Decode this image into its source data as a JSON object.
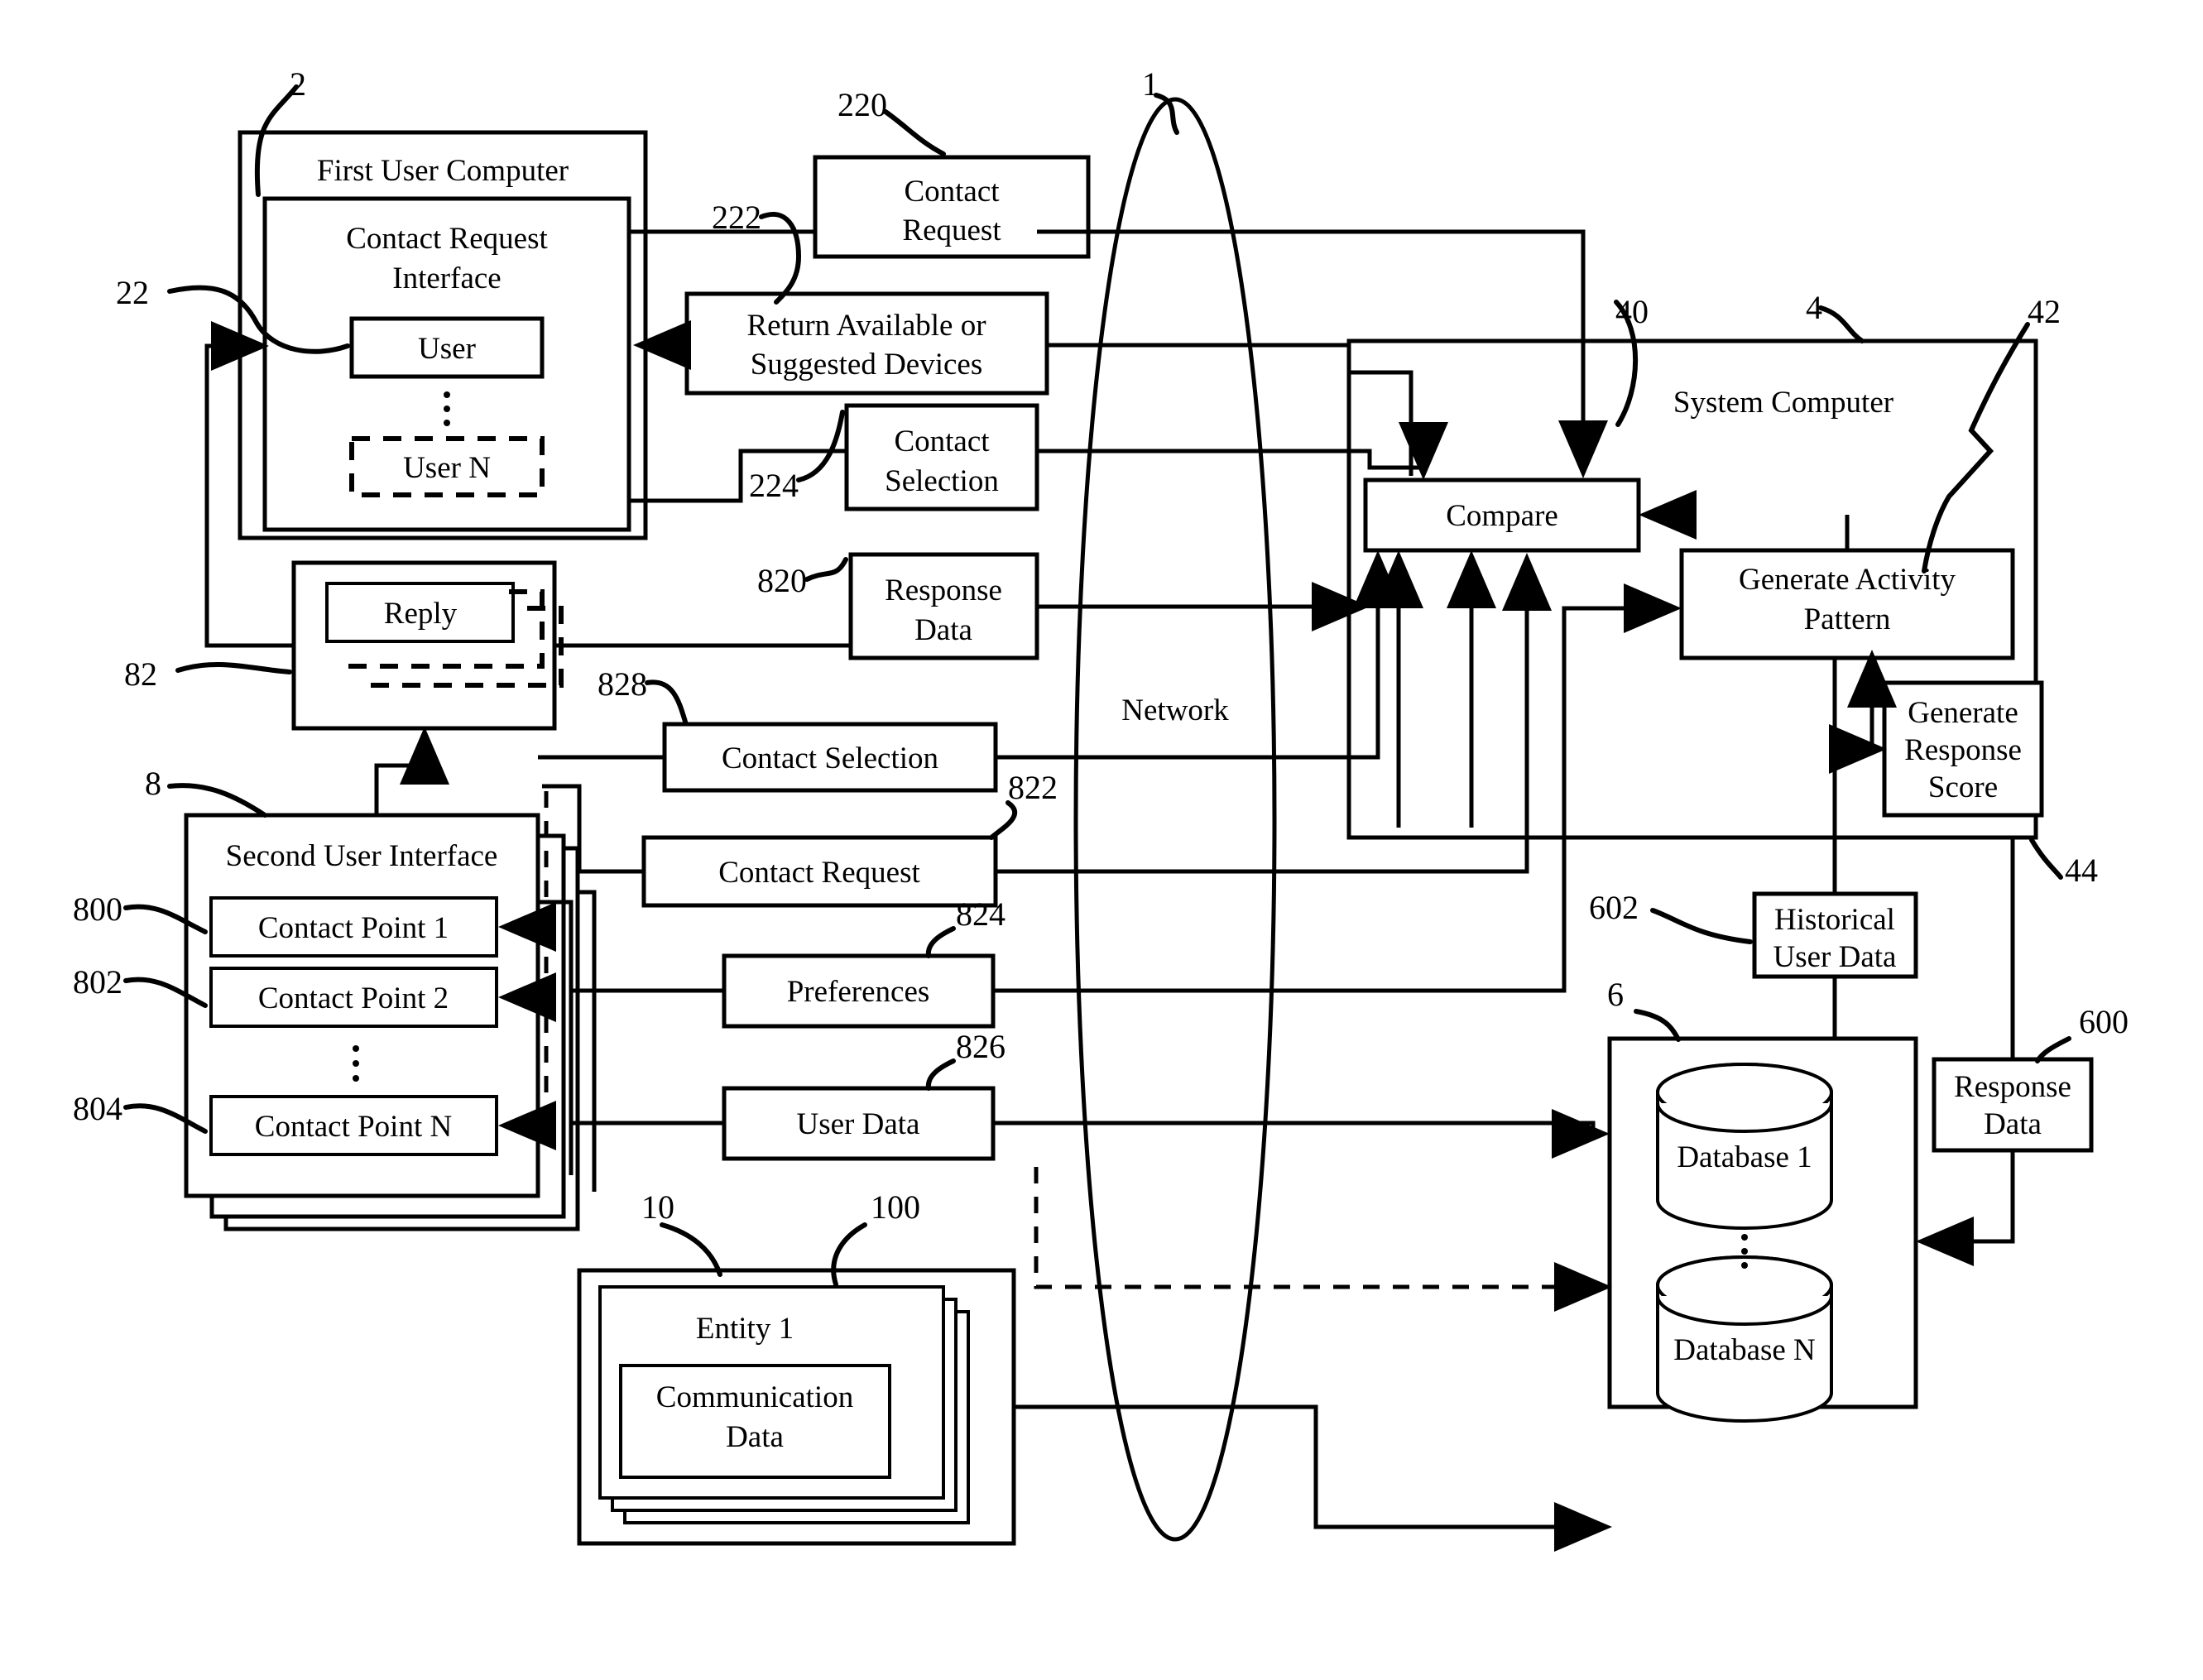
{
  "figure": {
    "type": "patent-system-block-diagram",
    "title_text_elements": [
      "First User Computer",
      "Contact Request Interface",
      "User",
      "User N",
      "Reply",
      "Second User Interface",
      "Contact Point 1",
      "Contact Point 2",
      "Contact Point N",
      "Entity 1",
      "Communication Data",
      "Network",
      "Contact Request",
      "Return Available or Suggested Devices",
      "Contact Selection",
      "Response Data",
      "Preferences",
      "User Data",
      "System Computer",
      "Compare",
      "Generate Activity Pattern",
      "Generate Response Score",
      "Historical User Data",
      "Database 1",
      "Database N"
    ]
  },
  "first_user_computer": {
    "label": "First User Computer",
    "ref": "2",
    "interface": {
      "label_line1": "Contact Request",
      "label_line2": "Interface",
      "ref": "22"
    },
    "users": [
      {
        "label": "User",
        "style": "solid"
      },
      {
        "label": "User N",
        "style": "dashed"
      }
    ],
    "ellipsis": "⋮"
  },
  "reply_panel": {
    "label": "Reply",
    "ref": "82"
  },
  "second_user_interface": {
    "label": "Second User Interface",
    "ref": "8",
    "contact_points": [
      {
        "label": "Contact Point 1",
        "ref": "800"
      },
      {
        "label": "Contact Point 2",
        "ref": "802"
      },
      {
        "label": "Contact Point N",
        "ref": "804"
      }
    ],
    "ellipsis": "⋮"
  },
  "entity_stack": {
    "ref": "10",
    "inner_ref": "100",
    "entity_label": "Entity 1",
    "data_label_line1": "Communication",
    "data_label_line2": "Data"
  },
  "network": {
    "label": "Network",
    "ref": "1"
  },
  "message_boxes": [
    {
      "id": "contact_request_220",
      "ref": "220",
      "line1": "Contact",
      "line2": "Request"
    },
    {
      "id": "return_devices_222",
      "ref": "222",
      "line1": "Return Available or",
      "line2": "Suggested Devices"
    },
    {
      "id": "contact_selection_224",
      "ref": "224",
      "line1": "Contact",
      "line2": "Selection"
    },
    {
      "id": "response_data_820",
      "ref": "820",
      "line1": "Response",
      "line2": "Data"
    },
    {
      "id": "contact_selection_828",
      "ref": "828",
      "line1": "Contact Selection",
      "line2": ""
    },
    {
      "id": "contact_request_822",
      "ref": "822",
      "line1": "Contact Request",
      "line2": ""
    },
    {
      "id": "preferences_824",
      "ref": "824",
      "line1": "Preferences",
      "line2": ""
    },
    {
      "id": "user_data_826",
      "ref": "826",
      "line1": "User Data",
      "line2": ""
    }
  ],
  "system_computer": {
    "label": "System Computer",
    "ref": "4",
    "ref_left": "40",
    "ref_right": "42",
    "ref_bottom": "44",
    "compare": {
      "label": "Compare"
    },
    "generate_activity_pattern": {
      "line1": "Generate Activity",
      "line2": "Pattern"
    },
    "generate_response_score": {
      "line1": "Generate",
      "line2": "Response",
      "line3": "Score"
    }
  },
  "historical_user_data": {
    "line1": "Historical",
    "line2": "User Data",
    "ref": "602"
  },
  "response_data_out": {
    "line1": "Response",
    "line2": "Data",
    "ref": "600"
  },
  "database_block": {
    "ref": "6",
    "databases": [
      {
        "label": "Database 1"
      },
      {
        "label": "Database N"
      }
    ],
    "ellipsis": "⋮"
  },
  "colors": {
    "ink": "#000000",
    "paper": "#ffffff"
  }
}
